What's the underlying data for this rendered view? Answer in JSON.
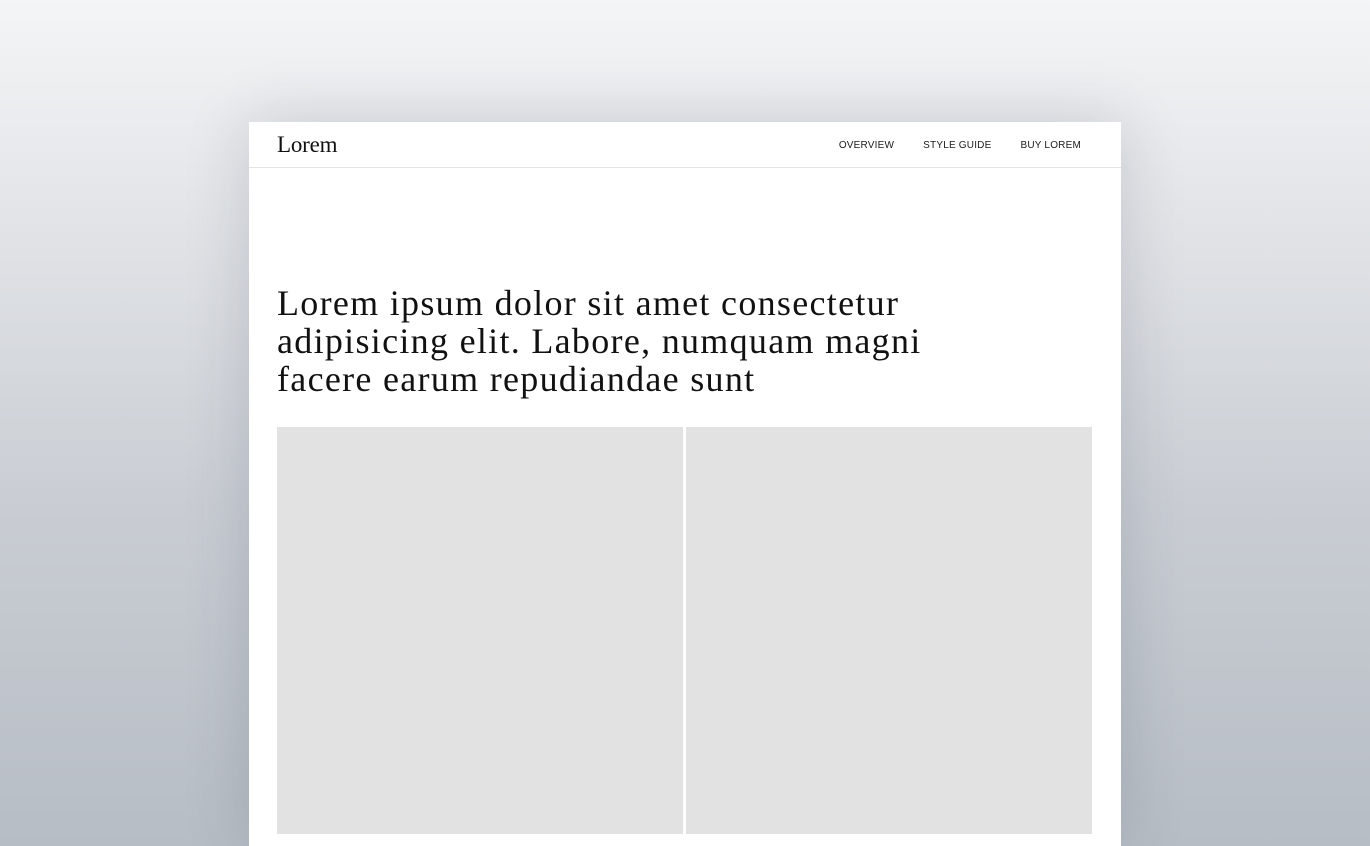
{
  "brand": {
    "name": "Lorem"
  },
  "nav": {
    "items": [
      {
        "label": "OVERVIEW"
      },
      {
        "label": "STYLE GUIDE"
      },
      {
        "label": "BUY LOREM"
      }
    ]
  },
  "hero": {
    "headline": "Lorem ipsum dolor sit amet consectetur adipisicing elit. Labore, numquam magni facere earum repudiandae sunt"
  },
  "colors": {
    "page_background": "#ffffff",
    "placeholder": "#e2e2e2",
    "text": "#111111"
  }
}
